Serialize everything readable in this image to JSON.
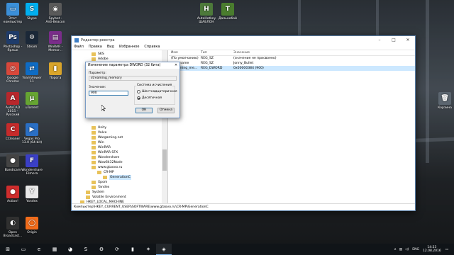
{
  "desktop_icons": [
    {
      "label": "Этот компьютер",
      "glyph": "▭",
      "color": "#3b8fd8",
      "icon": "computer-icon"
    },
    {
      "label": "Skype",
      "glyph": "S",
      "color": "#00aff0",
      "icon": "skype-icon"
    },
    {
      "label": "Spybot - Anti-Beacon",
      "glyph": "◉",
      "color": "#5a5a5a",
      "icon": "spybot-icon"
    },
    {
      "label": "Photoshop - Ярлык",
      "glyph": "Ps",
      "color": "#1f3c6b",
      "icon": "photoshop-icon"
    },
    {
      "label": "Steam",
      "glyph": "⚙",
      "color": "#1b2838",
      "icon": "steam-icon"
    },
    {
      "label": "WinRAR - Memor...",
      "glyph": "▤",
      "color": "#7a2d8a",
      "icon": "winrar-icon"
    },
    {
      "label": "Google Chrome",
      "glyph": "◎",
      "color": "#d8483b",
      "icon": "chrome-icon"
    },
    {
      "label": "TeamViewer 11",
      "glyph": "⇄",
      "color": "#0e6cc4",
      "icon": "teamviewer-icon"
    },
    {
      "label": "Порога",
      "glyph": "▮",
      "color": "#d9a52b",
      "icon": "folder-icon"
    },
    {
      "label": "AutoCAD 2015 - Русский",
      "glyph": "A",
      "color": "#b8272c",
      "icon": "autocad-icon"
    },
    {
      "label": "uTorrent",
      "glyph": "µ",
      "color": "#66a532",
      "icon": "utorrent-icon"
    },
    {
      "label": "CCleaner",
      "glyph": "C",
      "color": "#c62b2b",
      "icon": "ccleaner-icon"
    },
    {
      "label": "Vegas Pro 13.0 (64-bit)",
      "glyph": "▶",
      "color": "#2a6fc4",
      "icon": "vegas-icon"
    },
    {
      "label": "Bandicam",
      "glyph": "●",
      "color": "#444",
      "icon": "bandicam-icon"
    },
    {
      "label": "Wondershare Filmora",
      "glyph": "F",
      "color": "#3a3fc6",
      "icon": "filmora-icon"
    },
    {
      "label": "Action!",
      "glyph": "●",
      "color": "#cf2d2d",
      "icon": "action-icon"
    },
    {
      "label": "Yandex",
      "glyph": "Y",
      "color": "#e8e8e8",
      "icon": "yandex-icon"
    },
    {
      "label": "Open Broadcast...",
      "glyph": "◐",
      "color": "#303030",
      "icon": "obs-icon"
    },
    {
      "label": "Origin",
      "glyph": "◯",
      "color": "#f26c1b",
      "icon": "origin-icon"
    },
    {
      "label": "AutoHotkey ШАБЛОН",
      "glyph": "H",
      "color": "#4d7a3a",
      "icon": "autohotkey-icon"
    },
    {
      "label": "Дальнобой",
      "glyph": "T",
      "color": "#4a7d2e",
      "icon": "game-icon"
    },
    {
      "label": "Корзина",
      "glyph": "🗑",
      "color": "#5c6670",
      "icon": "recycle-bin-icon"
    }
  ],
  "regedit": {
    "title": "Редактор реестра",
    "menu": [
      "Файл",
      "Правка",
      "Вид",
      "Избранное",
      "Справка"
    ],
    "tree": [
      {
        "label": "SKS",
        "indent": 0
      },
      {
        "label": "Adobe",
        "indent": 0
      },
      {
        "label": "Unity",
        "indent": 0
      },
      {
        "label": "Valve",
        "indent": 0
      },
      {
        "label": "Wargaming.net",
        "indent": 0
      },
      {
        "label": "Win",
        "indent": 0
      },
      {
        "label": "WinRAR",
        "indent": 0
      },
      {
        "label": "WinRAR SFX",
        "indent": 0
      },
      {
        "label": "Wondershare",
        "indent": 0
      },
      {
        "label": "Wow6432Node",
        "indent": 0
      },
      {
        "label": "www.gtaovo.ru",
        "indent": 0
      },
      {
        "label": "CR-MP",
        "indent": 1
      },
      {
        "label": "GenerationC",
        "indent": 2,
        "selected": true
      },
      {
        "label": "Xpom",
        "indent": 0
      },
      {
        "label": "Yandex",
        "indent": 0
      },
      {
        "label": "System",
        "indent": -1
      },
      {
        "label": "Volatile Environment",
        "indent": -1
      },
      {
        "label": "HKEY_LOCAL_MACHINE",
        "indent": -2
      }
    ],
    "columns": {
      "name": "Имя",
      "type": "Тип",
      "data": "Значение"
    },
    "rows": [
      {
        "name": "(По умолчанию)",
        "type": "REG_SZ",
        "data": "(значение не присвоено)",
        "selected": false
      },
      {
        "name": "user_name",
        "type": "REG_SZ",
        "data": "Jonny_Bullet",
        "selected": false
      },
      {
        "name": "streaming_me...",
        "type": "REG_DWORD",
        "data": "0x00000384 (900)",
        "selected": true
      }
    ],
    "status_path": "Компьютер\\HKEY_CURRENT_USER\\SOFTWARE\\www.gtaovo.ru\\CR-MP\\GenerationC"
  },
  "dialog": {
    "title": "Изменение параметра DWORD (32 бита)",
    "param_label": "Параметр:",
    "param_value": "streaming_memory",
    "value_label": "Значение:",
    "value_value": "900",
    "base_label": "Система исчисления",
    "hex_label": "Шестнадцатеричная",
    "dec_label": "Десятичная",
    "ok_label": "ОК",
    "cancel_label": "Отмена"
  },
  "taskbar": {
    "items": [
      "⊞",
      "▭",
      "e",
      "▦",
      "◕",
      "S",
      "⚙",
      "⟳",
      "▮",
      "✶",
      "◈"
    ],
    "language": "ENG",
    "time": "14:23",
    "date": "12.08.2016"
  }
}
